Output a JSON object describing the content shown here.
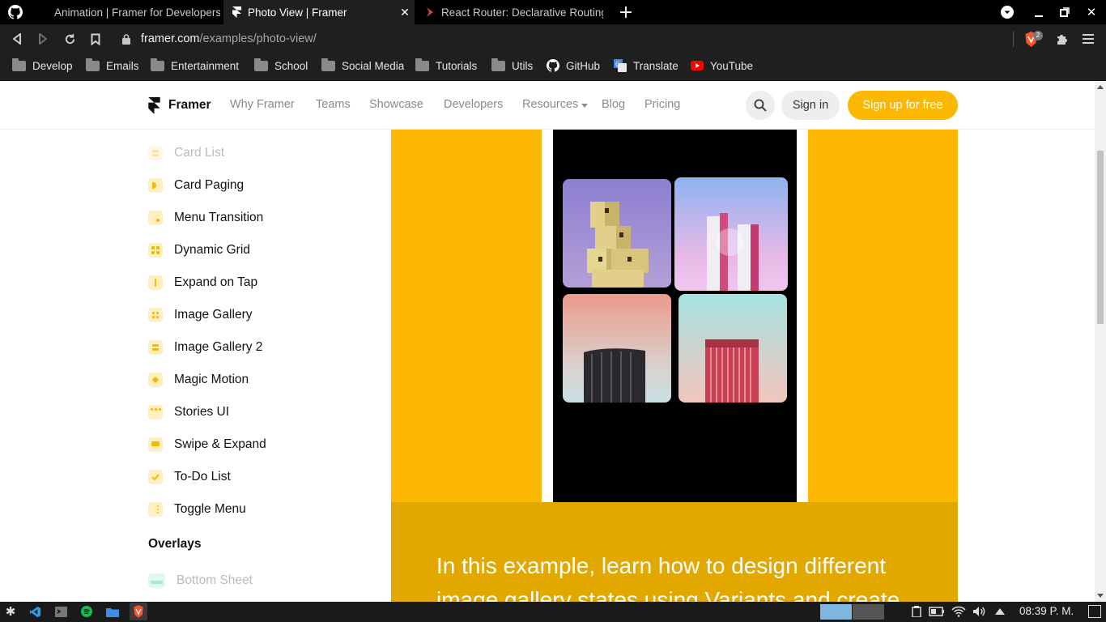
{
  "browser": {
    "tabs": [
      {
        "title": "Animation | Framer for Developers",
        "active": false
      },
      {
        "title": "Photo View | Framer",
        "active": true
      },
      {
        "title": "React Router: Declarative Routing",
        "active": false
      }
    ],
    "url_host": "framer.com",
    "url_path": "/examples/photo-view/",
    "shield_count": "2",
    "bookmarks": [
      {
        "label": "Develop",
        "icon": "folder-icon"
      },
      {
        "label": "Emails",
        "icon": "folder-icon"
      },
      {
        "label": "Entertainment",
        "icon": "folder-icon"
      },
      {
        "label": "School",
        "icon": "folder-icon"
      },
      {
        "label": "Social Media",
        "icon": "folder-icon"
      },
      {
        "label": "Tutorials",
        "icon": "folder-icon"
      },
      {
        "label": "Utils",
        "icon": "folder-icon"
      },
      {
        "label": "GitHub",
        "icon": "github-icon"
      },
      {
        "label": "Translate",
        "icon": "translate-icon"
      },
      {
        "label": "YouTube",
        "icon": "youtube-icon"
      }
    ]
  },
  "nav": {
    "brand": "Framer",
    "links": [
      "Why Framer",
      "Teams",
      "Showcase",
      "Developers",
      "Resources",
      "Blog",
      "Pricing"
    ],
    "signin": "Sign in",
    "signup": "Sign up for free"
  },
  "sidebar": {
    "items": [
      "Card List",
      "Card Paging",
      "Menu Transition",
      "Dynamic Grid",
      "Expand on Tap",
      "Image Gallery",
      "Image Gallery 2",
      "Magic Motion",
      "Stories UI",
      "Swipe & Expand",
      "To-Do List",
      "Toggle Menu"
    ],
    "section": "Overlays",
    "section_items": [
      "Bottom Sheet"
    ]
  },
  "main": {
    "caption": "In this example, learn how to design different image gallery states using Variants and create"
  },
  "taskbar": {
    "clock": "08:39 P. M."
  },
  "colors": {
    "accent": "#fcb800",
    "accent_dark": "#e3a800",
    "browser_bg": "#1f1f1f"
  }
}
